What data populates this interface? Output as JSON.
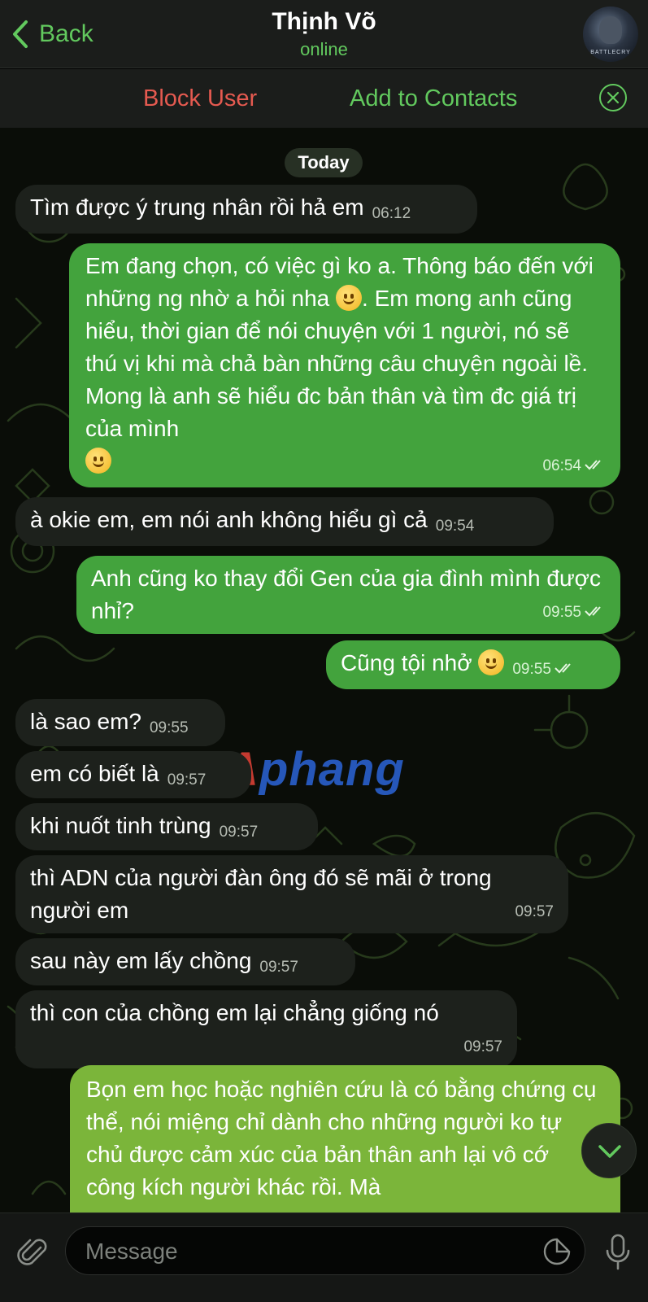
{
  "header": {
    "back_label": "Back",
    "contact_name": "Thịnh Võ",
    "status": "online",
    "avatar_text": "BATTLECRY"
  },
  "actions": {
    "block_user": "Block User",
    "add_to_contacts": "Add to Contacts"
  },
  "chat": {
    "date_chip": "Today",
    "watermark_first": "A",
    "watermark_rest": "phang",
    "messages": [
      {
        "direction": "in",
        "text": "Tìm được ý trung nhân rồi hả em",
        "time": "06:12"
      },
      {
        "direction": "out",
        "text": "Em đang chọn, có việc gì ko a. Thông báo đến với những ng nhờ a hỏi nha 🙂. Em mong anh cũng hiểu, thời gian để nói chuyện với 1 người, nó sẽ thú vị khi mà chả bàn những câu chuyện ngoài lề. Mong là anh sẽ hiểu đc bản thân và tìm đc  giá trị của mình 😊",
        "time": "06:54",
        "read": true
      },
      {
        "direction": "in",
        "text": "à okie em, em nói anh không hiểu gì cả",
        "time": "09:54"
      },
      {
        "direction": "out",
        "text": "Anh cũng ko thay đổi Gen của gia đình mình được nhỉ?",
        "time": "09:55",
        "read": true
      },
      {
        "direction": "out",
        "text": "Cũng tội nhở 🥺",
        "time": "09:55",
        "read": true
      },
      {
        "direction": "in",
        "text": "là sao em?",
        "time": "09:55"
      },
      {
        "direction": "in",
        "text": "em có biết là",
        "time": "09:57"
      },
      {
        "direction": "in",
        "text": "khi nuốt tinh trùng",
        "time": "09:57"
      },
      {
        "direction": "in",
        "text": "thì ADN của người đàn ông đó sẽ mãi ở trong người em",
        "time": "09:57"
      },
      {
        "direction": "in",
        "text": "sau này em lấy chồng",
        "time": "09:57"
      },
      {
        "direction": "in",
        "text": "thì con của chồng em lại chẳng giống nó",
        "time": "09:57"
      },
      {
        "direction": "out",
        "text": "Bọn em học hoặc nghiên cứu là có bằng chứng cụ thể, nói miệng chỉ dành cho những người ko tự chủ được cảm xúc của bản thân anh lại vô cớ công kích người khác rồi. Mà",
        "time": ""
      }
    ]
  },
  "composer": {
    "placeholder": "Message"
  },
  "icons": {
    "back": "chevron-left-icon",
    "close": "close-circle-icon",
    "attach": "paperclip-icon",
    "sticker": "sticker-icon",
    "mic": "microphone-icon",
    "scroll": "chevron-down-icon"
  },
  "colors": {
    "accent_green": "#62c95e",
    "block_red": "#e55a50",
    "outgoing_bubble": "#43a33d",
    "incoming_bubble": "#1d211c"
  }
}
